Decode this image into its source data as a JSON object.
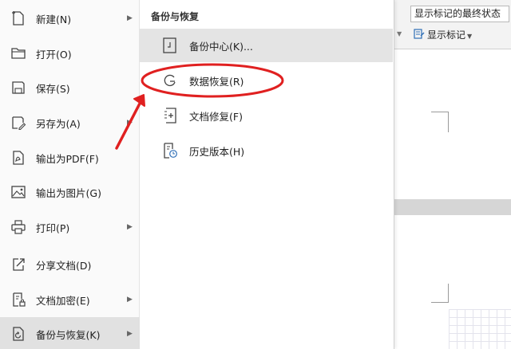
{
  "background": {
    "markup_select_value": "显示标记的最终状态",
    "show_markup_label": "显示标记"
  },
  "left_menu": {
    "items": [
      {
        "label": "新建(N)",
        "icon": "new-file-icon",
        "has_submenu": true
      },
      {
        "label": "打开(O)",
        "icon": "folder-open-icon",
        "has_submenu": false
      },
      {
        "label": "保存(S)",
        "icon": "save-icon",
        "has_submenu": false
      },
      {
        "label": "另存为(A)",
        "icon": "save-as-icon",
        "has_submenu": true
      },
      {
        "label": "输出为PDF(F)",
        "icon": "export-pdf-icon",
        "has_submenu": false
      },
      {
        "label": "输出为图片(G)",
        "icon": "export-image-icon",
        "has_submenu": false
      },
      {
        "label": "打印(P)",
        "icon": "printer-icon",
        "has_submenu": true
      },
      {
        "label": "分享文档(D)",
        "icon": "share-icon",
        "has_submenu": false
      },
      {
        "label": "文档加密(E)",
        "icon": "lock-document-icon",
        "has_submenu": true
      },
      {
        "label": "备份与恢复(K)",
        "icon": "backup-restore-icon",
        "has_submenu": true,
        "active": true
      }
    ]
  },
  "submenu": {
    "title": "备份与恢复",
    "items": [
      {
        "label": "备份中心(K)...",
        "icon": "backup-center-icon",
        "hover": true
      },
      {
        "label": "数据恢复(R)",
        "icon": "data-recovery-icon",
        "highlighted": true
      },
      {
        "label": "文档修复(F)",
        "icon": "document-repair-icon"
      },
      {
        "label": "历史版本(H)",
        "icon": "history-version-icon"
      }
    ]
  },
  "colors": {
    "annotation_red": "#e02020",
    "hover_gray": "#e4e4e4",
    "active_gray": "#e1e1e1"
  }
}
